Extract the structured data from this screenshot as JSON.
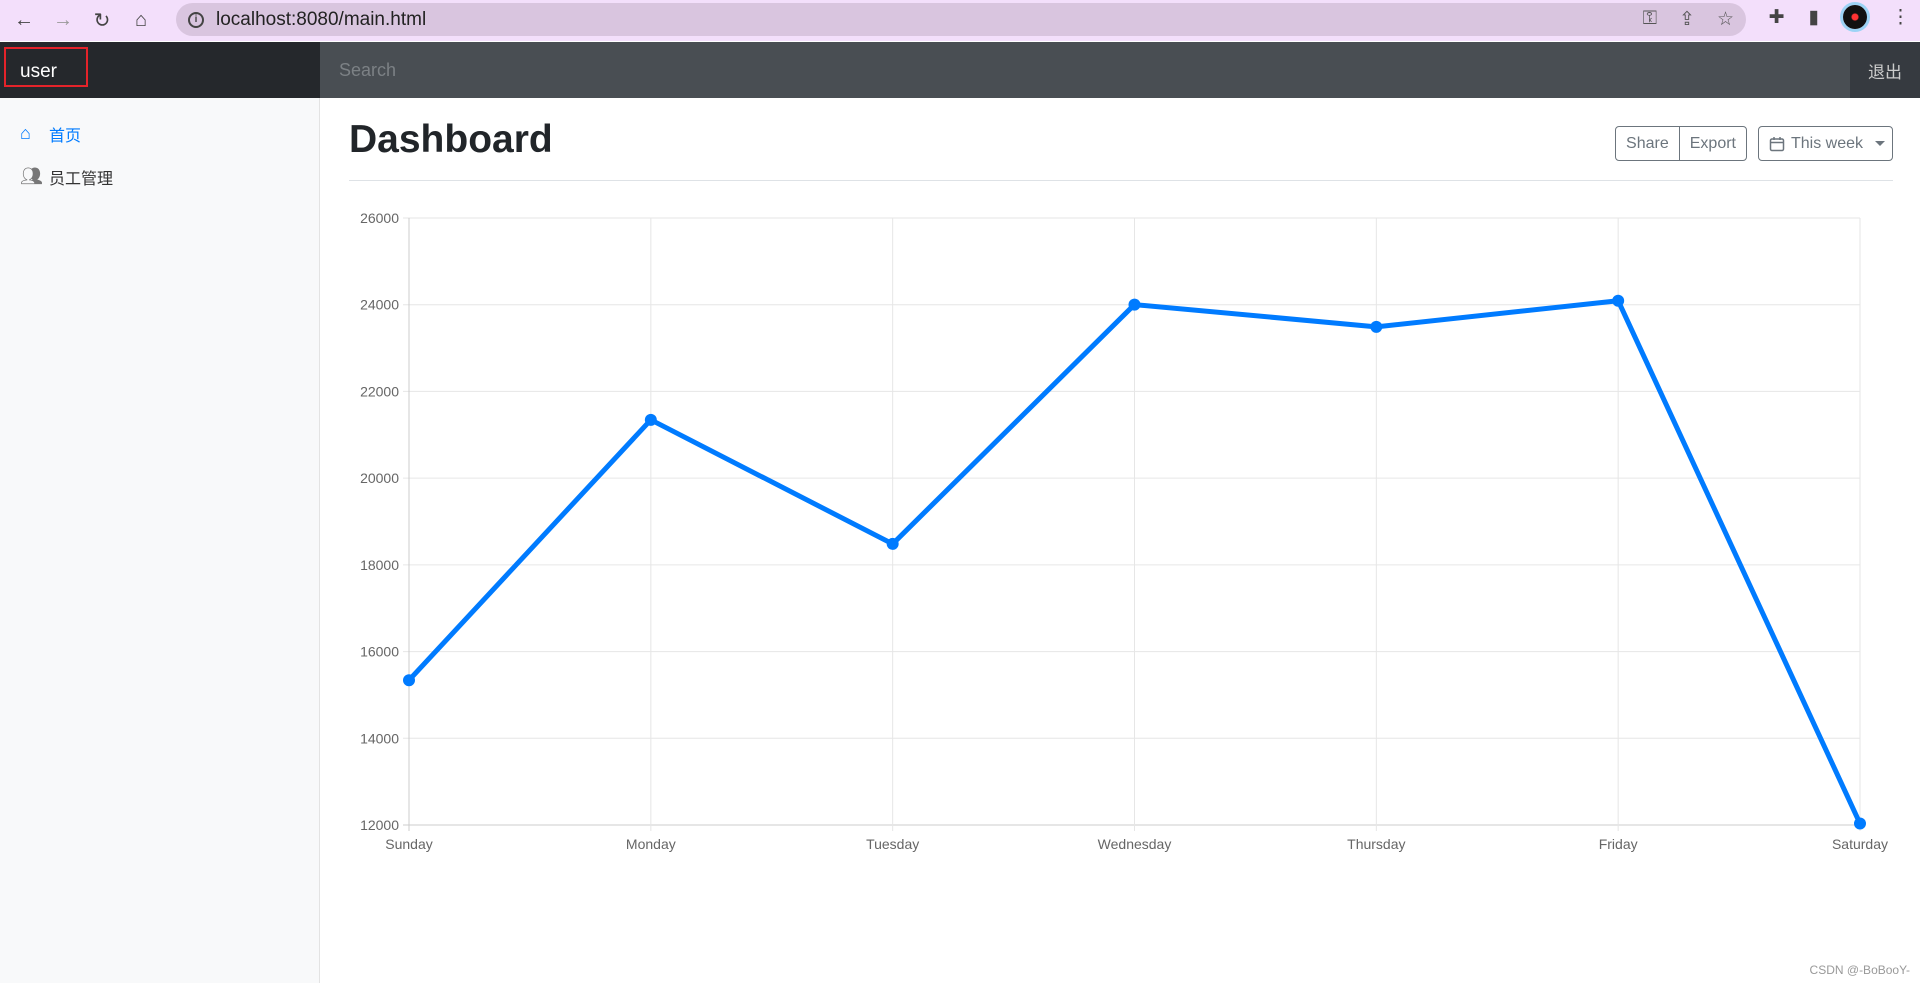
{
  "browser": {
    "url": "localhost:8080/main.html"
  },
  "navbar": {
    "brand": "user",
    "search_placeholder": "Search",
    "logout": "退出"
  },
  "sidebar": {
    "items": [
      {
        "label": "首页",
        "icon": "home-icon",
        "active": true
      },
      {
        "label": "员工管理",
        "icon": "users-icon",
        "active": false
      }
    ]
  },
  "main": {
    "title": "Dashboard",
    "share": "Share",
    "export": "Export",
    "period": "This week"
  },
  "watermark": "CSDN @-BoBooY-",
  "colors": {
    "accent": "#007bff"
  },
  "chart_data": {
    "type": "line",
    "categories": [
      "Sunday",
      "Monday",
      "Tuesday",
      "Wednesday",
      "Thursday",
      "Friday",
      "Saturday"
    ],
    "series": [
      {
        "values": [
          15339,
          21345,
          18483,
          24003,
          23489,
          24092,
          12034
        ]
      }
    ],
    "ylim": [
      12000,
      26000
    ],
    "yticks": [
      "12000",
      "14000",
      "16000",
      "18000",
      "20000",
      "22000",
      "24000",
      "26000"
    ],
    "grid": true,
    "color": "#007bff"
  }
}
